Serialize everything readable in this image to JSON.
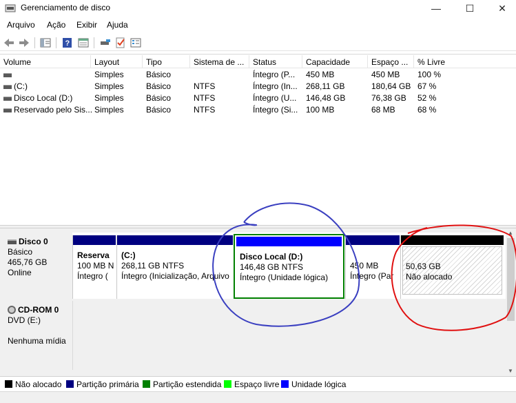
{
  "window": {
    "title": "Gerenciamento de disco",
    "minimize": "—",
    "maximize": "☐",
    "close": "✕"
  },
  "menu": [
    "Arquivo",
    "Ação",
    "Exibir",
    "Ajuda"
  ],
  "toolbar": [
    "back-icon",
    "forward-icon",
    "console-tree-icon",
    "help-icon",
    "properties-icon",
    "connect-icon",
    "check-icon",
    "list-icon"
  ],
  "volumes": {
    "columns": [
      "Volume",
      "Layout",
      "Tipo",
      "Sistema de ...",
      "Status",
      "Capacidade",
      "Espaço ...",
      "% Livre"
    ],
    "rows": [
      [
        "",
        "Simples",
        "Básico",
        "",
        "Íntegro (P...",
        "450 MB",
        "450 MB",
        "100 %"
      ],
      [
        "(C:)",
        "Simples",
        "Básico",
        "NTFS",
        "Íntegro (In...",
        "268,11 GB",
        "180,64 GB",
        "67 %"
      ],
      [
        "Disco Local (D:)",
        "Simples",
        "Básico",
        "NTFS",
        "Íntegro (U...",
        "146,48 GB",
        "76,38 GB",
        "52 %"
      ],
      [
        "Reservado pelo Sis...",
        "Simples",
        "Básico",
        "NTFS",
        "Íntegro (Si...",
        "100 MB",
        "68 MB",
        "68 %"
      ]
    ]
  },
  "disk0": {
    "name": "Disco 0",
    "type": "Básico",
    "size": "465,76 GB",
    "state": "Online",
    "partitions": [
      {
        "name": "Reserva",
        "size": "100 MB N",
        "status": "Íntegro (",
        "bar_color": "#000080"
      },
      {
        "name": "(C:)",
        "size": "268,11 GB NTFS",
        "status": "Íntegro (Inicialização, Arquivo",
        "bar_color": "#000080"
      },
      {
        "name": "Disco Local  (D:)",
        "size": "146,48 GB NTFS",
        "status": "Íntegro (Unidade lógica)",
        "bar_color": "#0000ff"
      },
      {
        "name": "",
        "size": "450 MB",
        "status": "Íntegro (Par",
        "bar_color": "#000080"
      },
      {
        "name": "",
        "size": "50,63 GB",
        "status": "Não alocado",
        "bar_color": "#000000"
      }
    ]
  },
  "cdrom": {
    "name": "CD-ROM 0",
    "drive": "DVD (E:)",
    "media": "Nenhuma mídia"
  },
  "legend": [
    {
      "label": "Não alocado",
      "color": "#000000"
    },
    {
      "label": "Partição primária",
      "color": "#000080"
    },
    {
      "label": "Partição estendida",
      "color": "#008000"
    },
    {
      "label": "Espaço livre",
      "color": "#00ff00"
    },
    {
      "label": "Unidade lógica",
      "color": "#0000ff"
    }
  ],
  "annotations": {
    "blue_circle_color": "#3a3fc0",
    "red_circle_color": "#e01010"
  }
}
